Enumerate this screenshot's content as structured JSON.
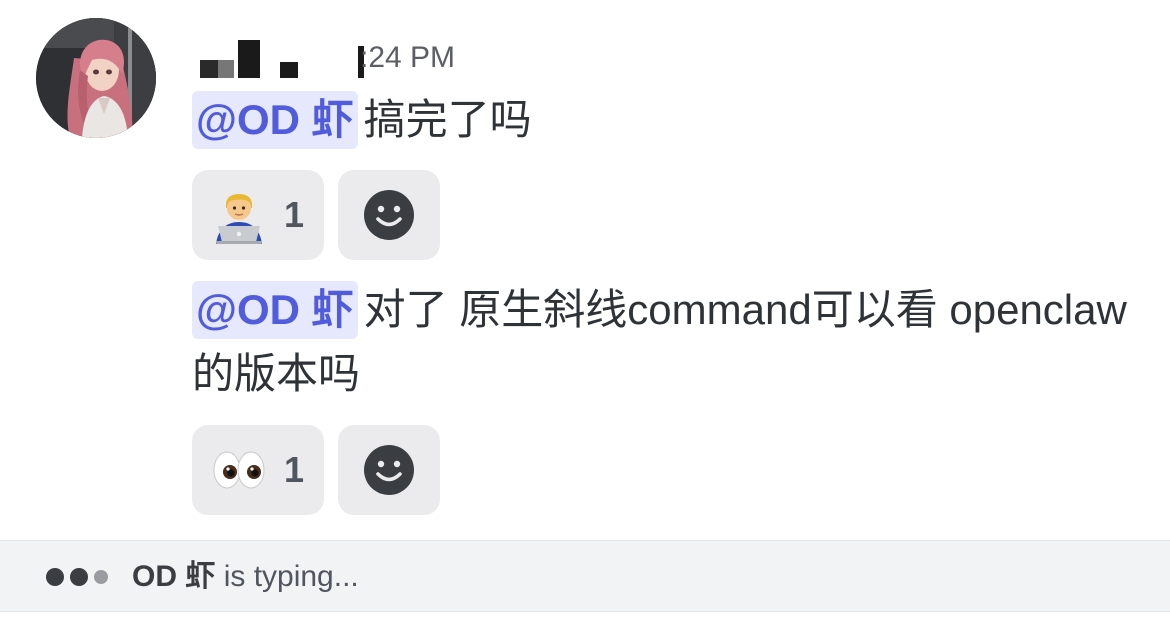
{
  "message": {
    "timestamp": ":24 PM",
    "lines": [
      {
        "mention": "@OD 虾",
        "text": "搞完了吗",
        "reactions": [
          {
            "emoji": "technologist-emoji",
            "count": "1"
          }
        ]
      },
      {
        "mention": "@OD 虾",
        "text": "对了 原生斜线command可以看 openclaw的版本吗",
        "reactions": [
          {
            "emoji": "eyes-emoji",
            "count": "1"
          }
        ]
      }
    ]
  },
  "typing": {
    "name": "OD 虾",
    "suffix": "is typing..."
  },
  "colors": {
    "mention_bg": "#e6e8fd",
    "mention_text": "#505cdc",
    "reaction_bg": "#ebebed",
    "typing_bar_bg": "#f2f3f5"
  }
}
